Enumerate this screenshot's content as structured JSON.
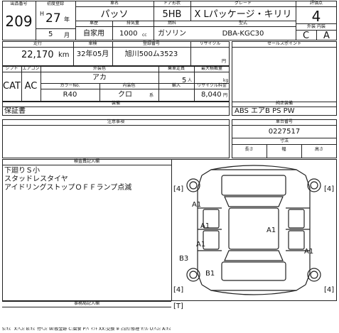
{
  "header": {
    "lot_label": "出品番号",
    "lot_no": "209",
    "first_reg_label": "初度登録",
    "era": "H",
    "year": "27",
    "year_unit": "年",
    "month": "5",
    "month_unit": "月",
    "car_name_label": "車名",
    "car_name": "パッソ",
    "doors_label": "ドア形状",
    "doors": "5HB",
    "grade_label": "グレード",
    "grade": "X Lパッケージ・キリリ",
    "score_label": "評価点",
    "score": "4",
    "usage_label": "車歴",
    "usage": "自家用",
    "displacement_label": "排気量",
    "displacement": "1000",
    "cc": "cc",
    "fuel_label": "燃料",
    "fuel": "ガソリン",
    "model_label": "型式",
    "model": "DBA-KGC30",
    "ext_int_label": "外装 内装",
    "ext_grade": "C",
    "int_grade": "A"
  },
  "row2": {
    "mileage_label": "走行",
    "mileage": "22,170",
    "km": "km",
    "shaken_label": "車検",
    "shaken": "32年05月",
    "plate_label": "登録番号",
    "plate": "旭川500ム3523",
    "recycle_label": "リサイクル",
    "recycle_unit": "円",
    "points_label": "セールスポイント"
  },
  "row3": {
    "shift_label": "シフト",
    "aircon_label": "エアコン",
    "shift": "CAT",
    "aircon": "AC",
    "color_label": "外装色",
    "color": "アカ",
    "capacity_label": "乗車定員",
    "capacity": "5",
    "capacity_unit": "人",
    "load_label": "最大積載量",
    "load_unit": "kg",
    "colorno_label": "カラーNo.",
    "colorno": "R40",
    "interior_label": "内装色",
    "interior": "クロ",
    "interior_unit": "系",
    "import_label": "輸入",
    "recycle_fee_label": "リサイクル料金",
    "recycle_fee": "8,040",
    "recycle_fee_unit": "円"
  },
  "equip": {
    "label": "装備",
    "left_value": "保証書",
    "right_label": "純正装備",
    "right_value": "ABS エアB PS PW"
  },
  "notes": {
    "label": "注意事項",
    "caution_label": "走行距離",
    "chassis_label": "車台番号",
    "chassis": "0227517",
    "size_label": "寸法",
    "size_headers": [
      "長さ",
      "幅",
      "高さ"
    ]
  },
  "inspection": {
    "label": "検査員記入欄",
    "lines": [
      "下廻りＳ小",
      "スタッドレスタイヤ",
      "アイドリングストップＯＦＦランプ点滅"
    ]
  },
  "diagram": {
    "codes": [
      "A1",
      "A1",
      "A1",
      "B3",
      "B1",
      "A1",
      "A1"
    ],
    "tire_marks": [
      "[4]",
      "[4]",
      "[4]",
      "[4]",
      "[T]"
    ]
  },
  "footer": {
    "label": "事務局記入欄",
    "text": "S:ｷｽﾞ X:ﾍｺﾐ B:ｷｽﾞ付ﾍｺﾐ W:板金跡 C:腐食 P:ﾍﾟｲﾝﾄ XX:交換 ※ 凸凹:修理 Y:ﾜﾚ U:ﾍｺﾐ A:ｷｽﾞ"
  }
}
